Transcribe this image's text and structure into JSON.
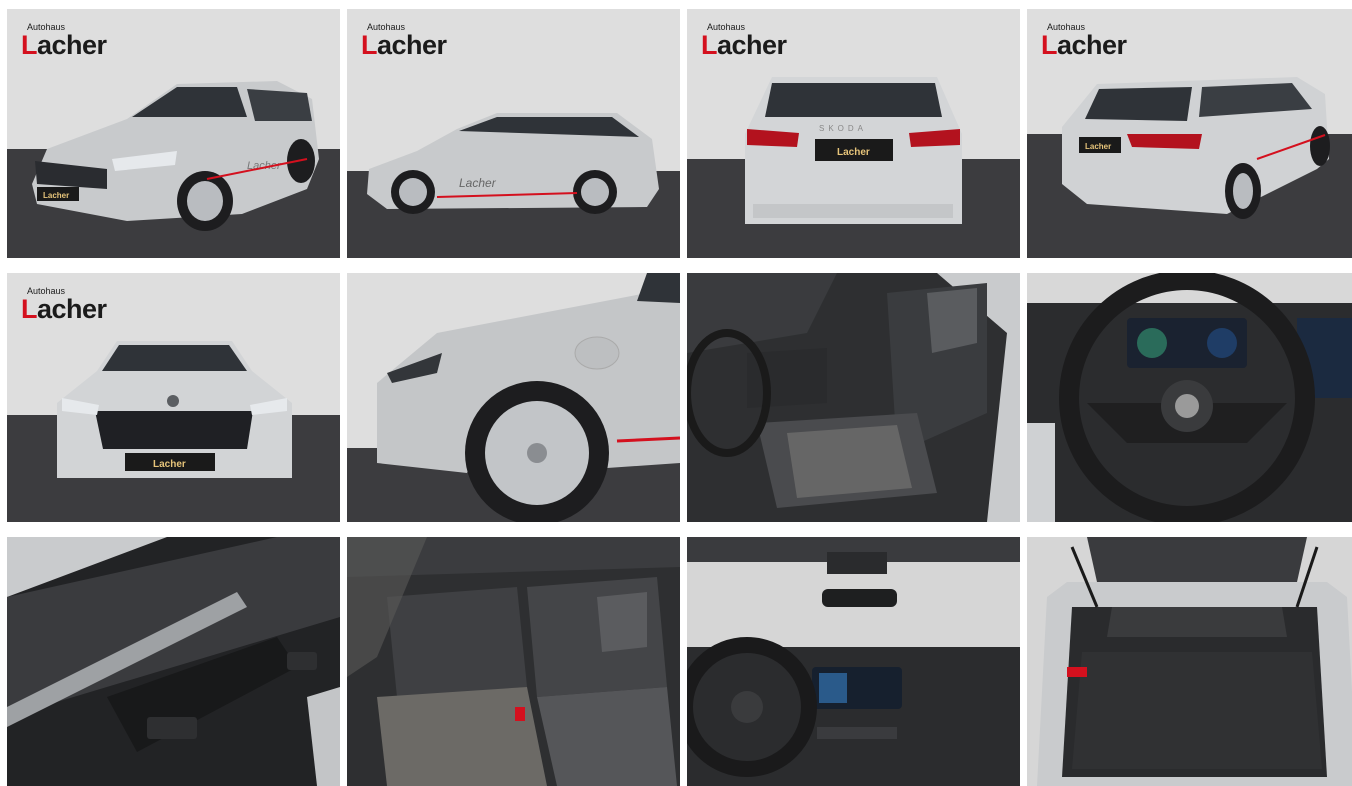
{
  "gallery": {
    "logo": {
      "small": "Autohaus",
      "big_first": "L",
      "big_rest": "acher"
    },
    "plate_text": "Lacher",
    "door_decal": "Lacher",
    "rear_badge": "SKODA",
    "colors": {
      "backdrop": "#dcdcdc",
      "floor": "#3d3d40",
      "body_silver": "#c9cbcd",
      "red_accent": "#d4101e",
      "interior_dark": "#2b2c2e"
    },
    "tiles": [
      {
        "view": "front-three-quarter",
        "has_logo": true
      },
      {
        "view": "side",
        "has_logo": true
      },
      {
        "view": "rear",
        "has_logo": true
      },
      {
        "view": "rear-three-quarter",
        "has_logo": true
      },
      {
        "view": "front",
        "has_logo": true
      },
      {
        "view": "wheel-closeup",
        "has_logo": false
      },
      {
        "view": "front-seat",
        "has_logo": false
      },
      {
        "view": "steering-wheel",
        "has_logo": false
      },
      {
        "view": "door-panel",
        "has_logo": false
      },
      {
        "view": "rear-seats",
        "has_logo": false
      },
      {
        "view": "dashboard",
        "has_logo": false
      },
      {
        "view": "trunk",
        "has_logo": false
      }
    ]
  }
}
